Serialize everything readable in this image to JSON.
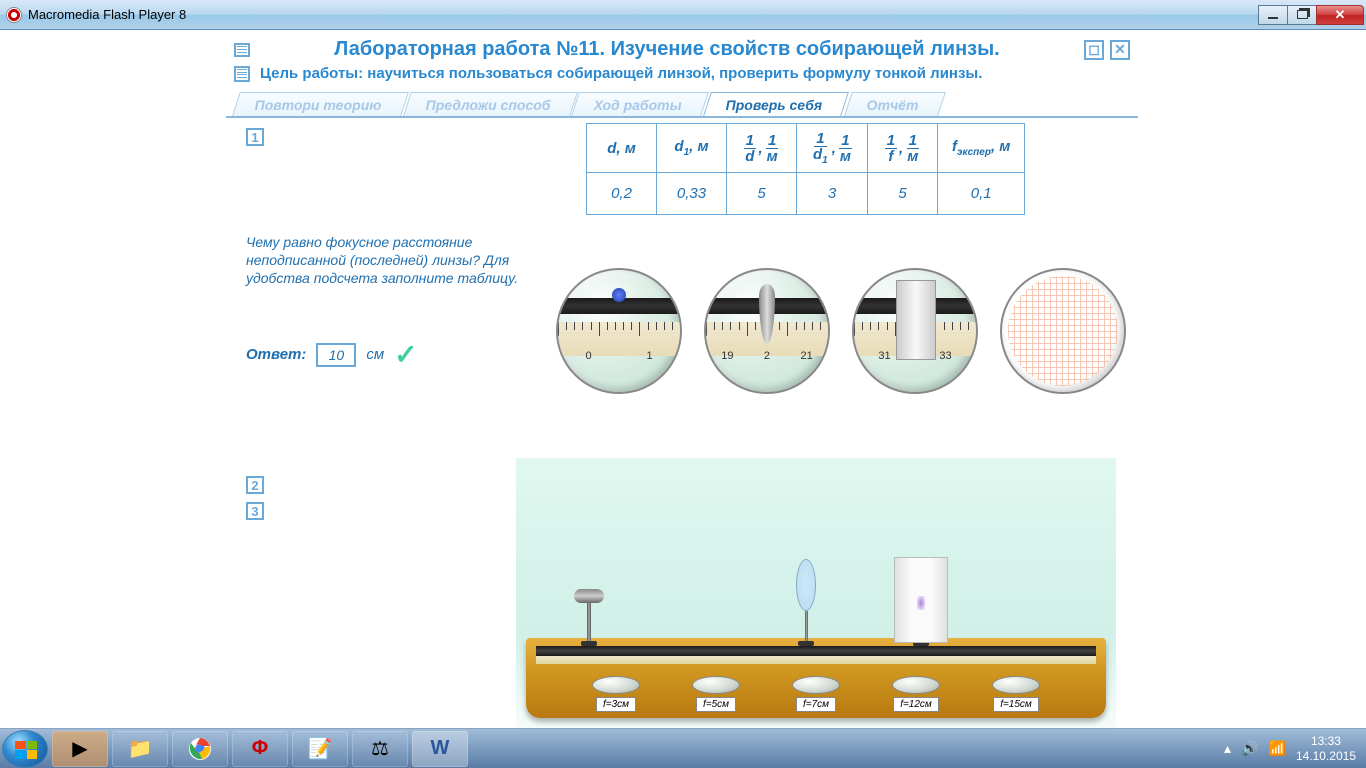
{
  "window": {
    "title": "Macromedia Flash Player 8"
  },
  "header": {
    "title": "Лабораторная работа №11.  Изучение свойств собирающей линзы.",
    "goal": "Цель работы: научиться пользоваться собирающей линзой, проверить формулу тонкой линзы."
  },
  "tabs": [
    {
      "label": "Повтори теорию",
      "active": false
    },
    {
      "label": "Предложи способ",
      "active": false
    },
    {
      "label": "Ход работы",
      "active": false
    },
    {
      "label": "Проверь себя",
      "active": true
    },
    {
      "label": "Отчёт",
      "active": false
    }
  ],
  "steps": {
    "s1": "1",
    "s2": "2",
    "s3": "3"
  },
  "table": {
    "headers": {
      "d": "d, м",
      "d1": "d₁, м",
      "inv_d": {
        "num": "1",
        "den": "d",
        "unit_num": "1",
        "unit_den": "м"
      },
      "inv_d1": {
        "num": "1",
        "den": "d₁",
        "unit_num": "1",
        "unit_den": "м"
      },
      "inv_f": {
        "num": "1",
        "den": "f",
        "unit_num": "1",
        "unit_den": "м"
      },
      "fexp": "fэкспер, м"
    },
    "row": {
      "d": "0,2",
      "d1": "0,33",
      "inv_d": "5",
      "inv_d1": "3",
      "inv_f": "5",
      "fexp": "0,1"
    }
  },
  "question": "Чему равно фокусное расстояние неподписанной (последней) линзы? Для удобства подсчета заполните таблицу.",
  "answer": {
    "label": "Ответ:",
    "value": "10",
    "unit": "см"
  },
  "magnifiers": {
    "m1": {
      "left": "0",
      "right": "1"
    },
    "m2": {
      "left": "19",
      "mid": "2",
      "right": "21"
    },
    "m3": {
      "left": "31",
      "right": "33"
    }
  },
  "lens_tray": [
    {
      "label": "f=3см"
    },
    {
      "label": "f=5см"
    },
    {
      "label": "f=7см"
    },
    {
      "label": "f=12см"
    },
    {
      "label": "f=15см"
    }
  ],
  "taskbar": {
    "time": "13:33",
    "date": "14.10.2015"
  }
}
